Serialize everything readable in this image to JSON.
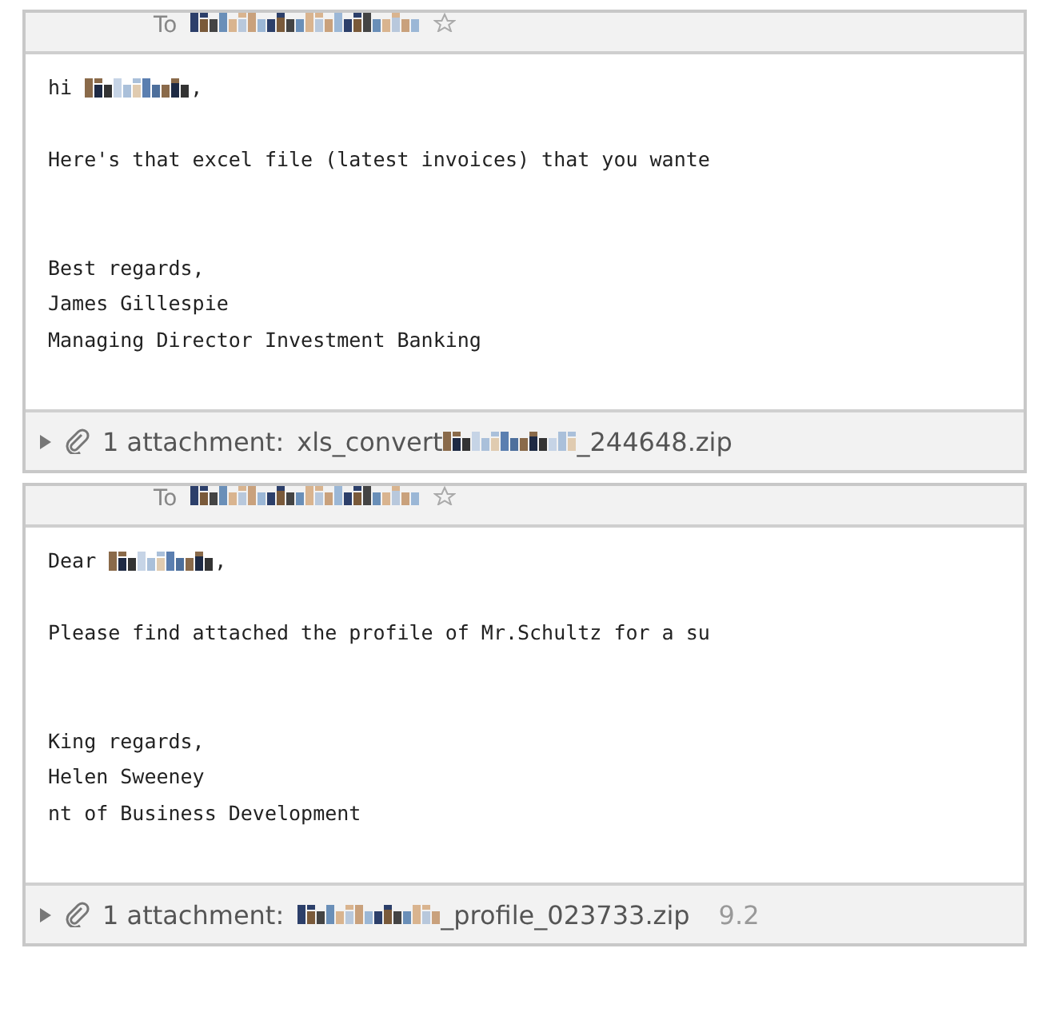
{
  "messages": [
    {
      "header": {
        "label": "To",
        "starred": false
      },
      "greeting": {
        "before": "hi",
        "after": ","
      },
      "lines": [
        "Here's that excel file (latest invoices) that you wante"
      ],
      "signature": [
        "Best regards,",
        "James Gillespie",
        "Managing Director Investment Banking"
      ],
      "attachment": {
        "count_label": "1 attachment:",
        "name_start": "xls_convert",
        "name_end": "_244648.zip"
      }
    },
    {
      "header": {
        "label": "To",
        "starred": false
      },
      "greeting": {
        "before": "Dear",
        "after": ","
      },
      "lines": [
        "Please find attached the profile of Mr.Schultz for a su"
      ],
      "signature": [
        "King regards,",
        "Helen Sweeney",
        "nt of Business Development"
      ],
      "attachment": {
        "count_label": "1 attachment:",
        "name_end": "_profile_023733.zip",
        "size": "9.2"
      }
    }
  ]
}
